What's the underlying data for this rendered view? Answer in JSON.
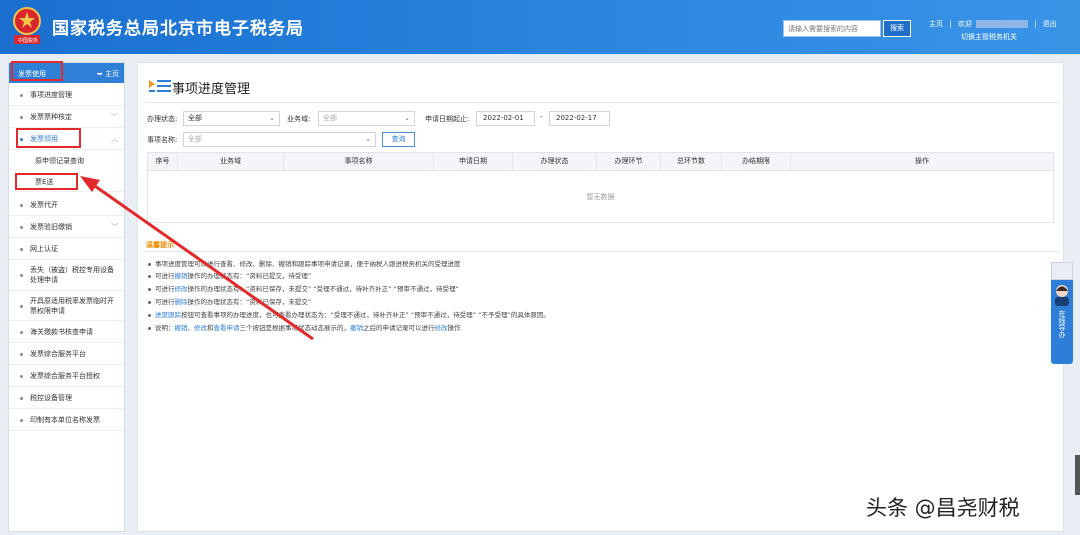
{
  "header": {
    "title": "国家税务总局北京市电子税务局",
    "emblem_text": "中国税务",
    "search_placeholder": "请输入需要搜索的内容",
    "search_button": "搜索",
    "link_home": "主页",
    "link_welcome": "欢迎",
    "link_logout": "退出",
    "link_switch": "切换主管税务机关"
  },
  "sidebar": {
    "title": "发票使用",
    "home": "主页",
    "items": [
      {
        "label": "事项进度管理"
      },
      {
        "label": "发票票种核定"
      },
      {
        "label": "发票领用"
      },
      {
        "label": "原申领记录查询"
      },
      {
        "label": "票E送"
      },
      {
        "label": "发票代开"
      },
      {
        "label": "发票验旧缴销"
      },
      {
        "label": "网上认证"
      },
      {
        "label": "丢失（被盗）税控专用设备处理申请"
      },
      {
        "label": "开具原适用税率发票临时开票权限申请"
      },
      {
        "label": "海关缴款书核查申请"
      },
      {
        "label": "发票综合服务平台"
      },
      {
        "label": "发票综合服务平台授权"
      },
      {
        "label": "税控设备管理"
      },
      {
        "label": "印制有本单位名称发票"
      }
    ]
  },
  "main": {
    "title": "事项进度管理",
    "filters": {
      "status_label": "办理状态:",
      "status_value": "全部",
      "domain_label": "业务域:",
      "domain_value": "全部",
      "date_label": "申请日期起止:",
      "date_from": "2022-02-01",
      "date_sep": "-",
      "date_to": "2022-02-17",
      "name_label": "事项名称:",
      "name_value": "全部",
      "query_button": "查询"
    },
    "table": {
      "headers": [
        "序号",
        "业务域",
        "事项名称",
        "申请日期",
        "办理状态",
        "办理环节",
        "总环节数",
        "办结期限",
        "操作"
      ],
      "empty": "暂无数据"
    },
    "tips": {
      "title": "温馨提示",
      "lines": [
        {
          "pre": "事项进度管理可以进行查看、修改、删除、撤销和跟踪事项申请记录，便于纳税人跟进税务机关的受理进度"
        },
        {
          "pre": "可进行",
          "hl": "撤销",
          "post": "操作的办理状态有：“资料已提交，待受理”"
        },
        {
          "pre": "可进行",
          "hl": "修改",
          "post": "操作的办理状态有：“资料已保存，未提交”  “受理不通过，待补齐补正”  “预审不通过，待受理”"
        },
        {
          "pre": "可进行",
          "hl": "删除",
          "post": "操作的办理状态有：“资料已保存，未提交”"
        },
        {
          "hl": "进度跟踪",
          "post": "按钮可查看事项的办理进度，也可查看办理状态为：“受理不通过，待补齐补正”  “预审不通过，待受理”  “不予受理”的具体原因。"
        },
        {
          "pre": "说明：",
          "hl": "撤销",
          "mid1": "、",
          "hl2": "修改",
          "mid2": "和",
          "hl3": "查看申请",
          "mid3": "三个按钮是根据事项状态动态展示的，",
          "hl4": "撤销",
          "post": "之后的申请记录可以进行",
          "hl5": "修改",
          "end": "操作"
        }
      ]
    }
  },
  "float": {
    "label": "在线导办"
  },
  "watermark": "头条 @昌尧财税",
  "colors": {
    "header": "#1a6fcf",
    "accent": "#2e7fd6",
    "annotation": "#e32a2a",
    "tips_title": "#f08a00"
  }
}
